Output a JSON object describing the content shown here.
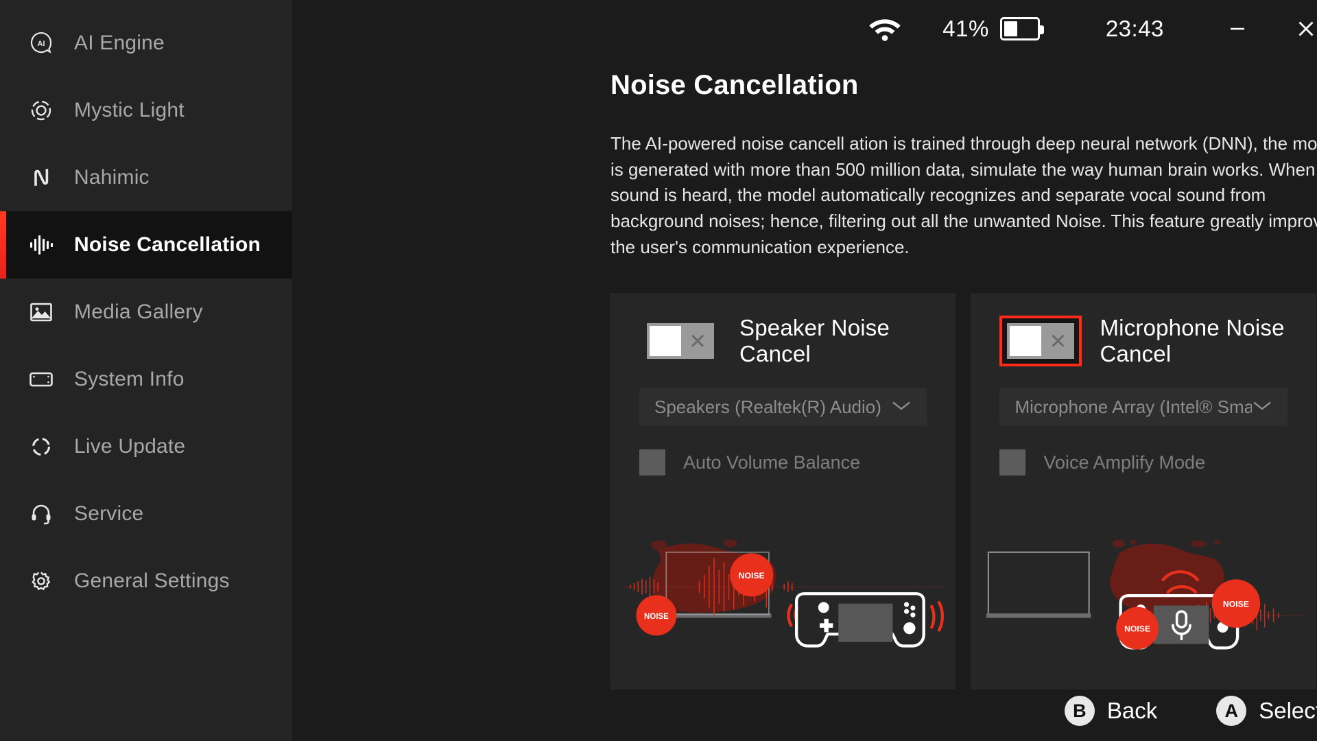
{
  "sidebar": {
    "items": [
      {
        "label": "AI Engine",
        "icon": "ai-engine-icon",
        "active": false
      },
      {
        "label": "Mystic Light",
        "icon": "mystic-light-icon",
        "active": false
      },
      {
        "label": "Nahimic",
        "icon": "nahimic-icon",
        "active": false
      },
      {
        "label": "Noise Cancellation",
        "icon": "noise-cancellation-icon",
        "active": true
      },
      {
        "label": "Media Gallery",
        "icon": "media-gallery-icon",
        "active": false
      },
      {
        "label": "System Info",
        "icon": "system-info-icon",
        "active": false
      },
      {
        "label": "Live Update",
        "icon": "live-update-icon",
        "active": false
      },
      {
        "label": "Service",
        "icon": "service-headset-icon",
        "active": false
      },
      {
        "label": "General Settings",
        "icon": "gear-icon",
        "active": false
      }
    ],
    "accent_color": "#ff3b1f"
  },
  "titlebar": {
    "wifi_icon": "wifi-icon",
    "battery_percent": "41%",
    "battery_level": 41,
    "clock": "23:43",
    "minimize_label": "—",
    "close_label": "✕"
  },
  "main": {
    "page_title": "Noise Cancellation",
    "description": "The AI-powered noise cancell ation is trained through deep neural network (DNN), the model is generated with more than 500 million data, simulate the way human brain works. When a sound is heard, the model automatically recognizes and separate vocal sound from background noises; hence, filtering out all the unwanted Noise. This feature greatly improves the user's communication experience."
  },
  "panels": [
    {
      "id": "speaker",
      "title": "Speaker Noise Cancel",
      "toggle_state": "off",
      "toggle_glyph": "✕",
      "focused": false,
      "device": "Speakers (Realtek(R) Audio)",
      "dropdown_icon": "chevron-down-icon",
      "option_label": "Auto Volume Balance",
      "option_checked": false,
      "illustration": "speaker-noise-illustration",
      "noise_bubbles": [
        "NOISE",
        "NOISE"
      ]
    },
    {
      "id": "microphone",
      "title": "Microphone Noise Cancel",
      "toggle_state": "off",
      "toggle_glyph": "✕",
      "focused": true,
      "device": "Microphone Array (Intel® Smart Sou…",
      "dropdown_icon": "chevron-down-icon",
      "option_label": "Voice Amplify Mode",
      "option_checked": false,
      "illustration": "microphone-noise-illustration",
      "noise_bubbles": [
        "NOISE",
        "NOISE"
      ]
    }
  ],
  "footer": {
    "back": {
      "badge": "B",
      "label": "Back"
    },
    "select": {
      "badge": "A",
      "label": "Select"
    }
  },
  "colors": {
    "accent_red": "#ff2a17",
    "noise_red": "#e8301c",
    "panel_bg": "#262626",
    "sidebar_bg": "#242424",
    "app_bg": "#1b1b1b"
  }
}
